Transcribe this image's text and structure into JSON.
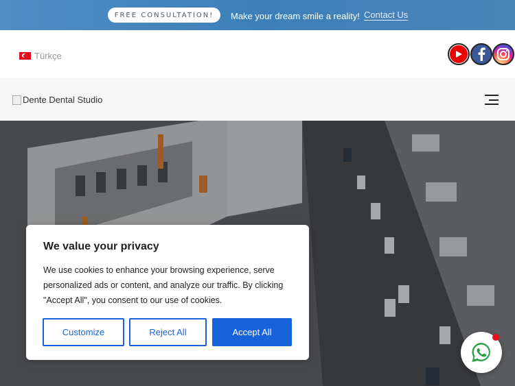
{
  "topbar": {
    "consult_label": "FREE CONSULTATION!",
    "tagline": "Make your dream smile a reality!",
    "contact_link": "Contact Us"
  },
  "langrow": {
    "language": "Türkçe",
    "social": [
      "youtube-icon",
      "facebook-icon",
      "instagram-icon"
    ]
  },
  "header": {
    "logo_alt": "Dente Dental Studio"
  },
  "cookie": {
    "title": "We value your privacy",
    "body": "We use cookies to enhance your browsing experience, serve personalized ads or content, and analyze our traffic. By clicking \"Accept All\", you consent to our use of cookies.",
    "customize": "Customize",
    "reject": "Reject All",
    "accept": "Accept All"
  },
  "colors": {
    "brand_blue": "#1863dc",
    "topbar": "#4a85b9"
  }
}
